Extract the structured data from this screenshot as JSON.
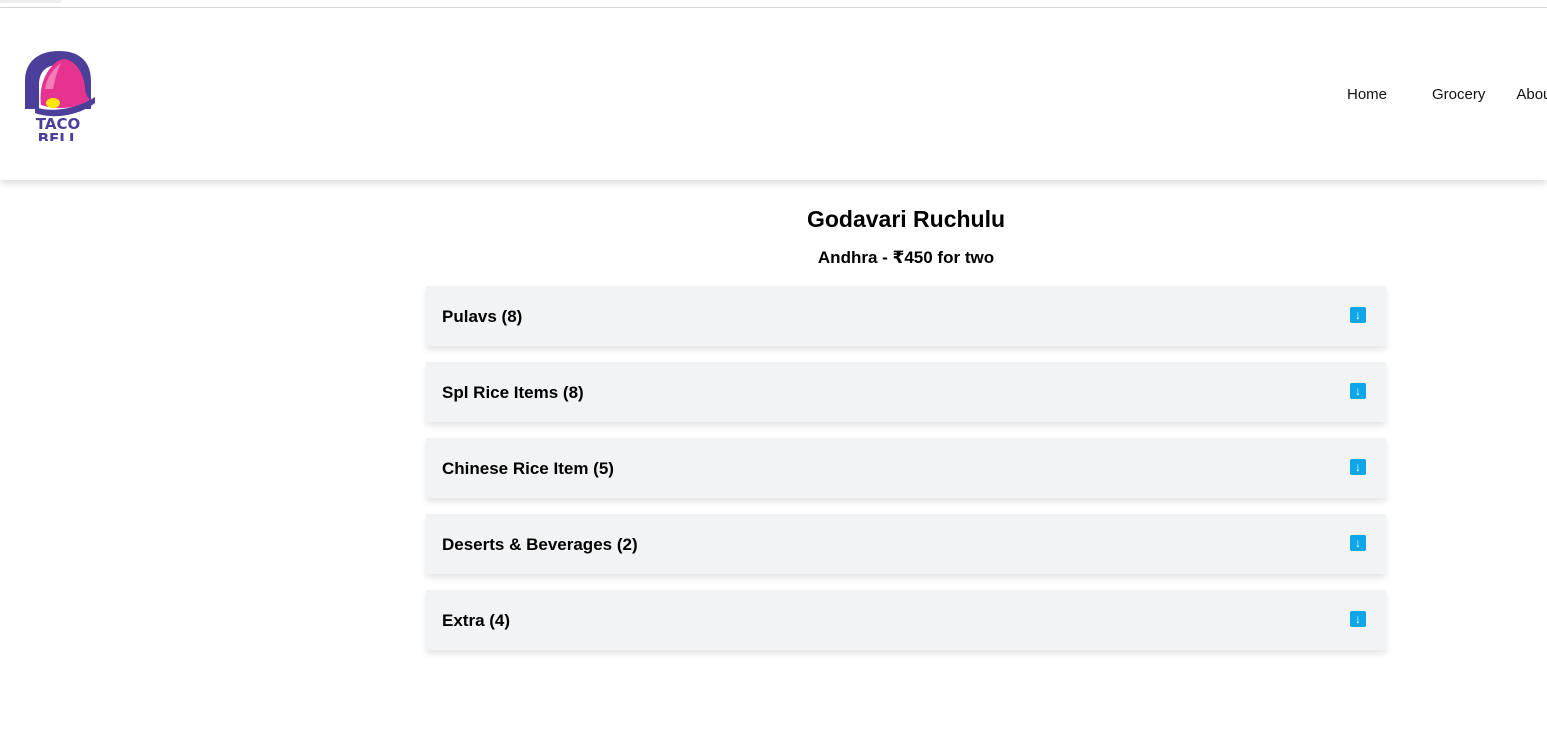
{
  "nav": {
    "items": [
      {
        "label": "Home"
      },
      {
        "label": "Grocery"
      },
      {
        "label": "About"
      }
    ]
  },
  "logo": {
    "line1": "TACO",
    "line2": "BELL",
    "colors": {
      "purple": "#4b3f9a",
      "pink": "#e6338f",
      "yellow": "#ffe600"
    }
  },
  "restaurant": {
    "name": "Godavari Ruchulu",
    "subtitle": "Andhra - ₹450 for two"
  },
  "categories": [
    {
      "label": "Pulavs (8)",
      "icon": "arrow-down-icon"
    },
    {
      "label": "Spl Rice Items (8)",
      "icon": "arrow-down-icon"
    },
    {
      "label": "Chinese Rice Item (5)",
      "icon": "arrow-down-icon"
    },
    {
      "label": "Deserts & Beverages (2)",
      "icon": "arrow-down-icon"
    },
    {
      "label": "Extra (4)",
      "icon": "arrow-down-icon"
    }
  ],
  "colors": {
    "accent": "#0ea5e9",
    "card_bg": "#f2f3f5"
  }
}
